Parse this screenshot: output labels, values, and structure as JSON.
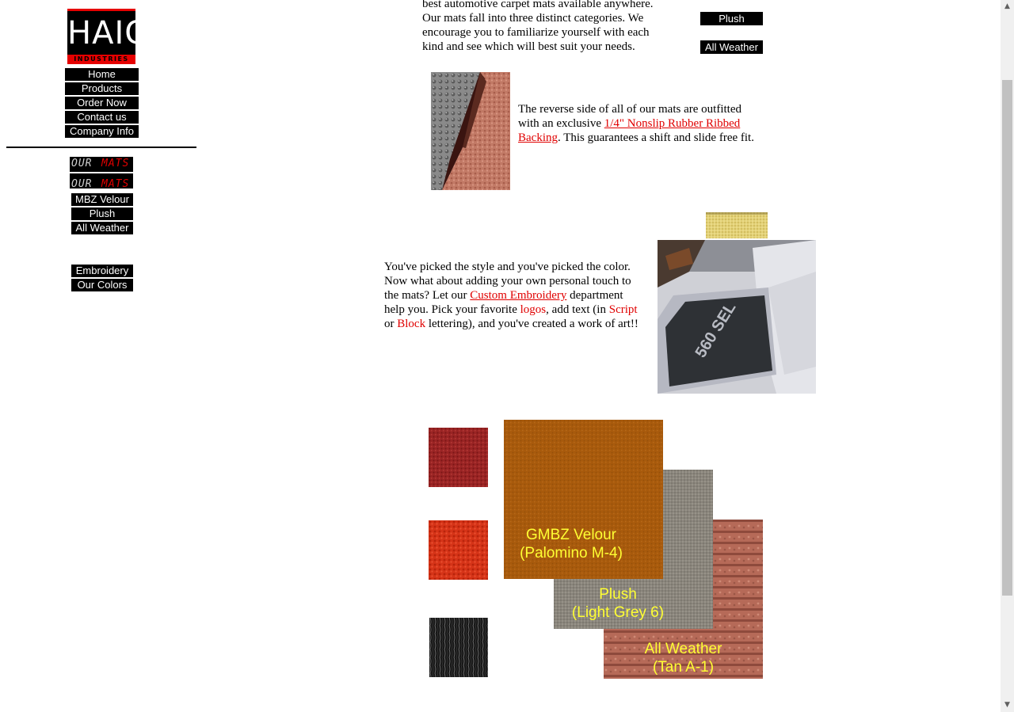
{
  "logo": {
    "word": "HAIG",
    "sub": "INDUSTRIES"
  },
  "nav": [
    "Home",
    "Products",
    "Order Now",
    "Contact us",
    "Company Info"
  ],
  "our_mats_banner": {
    "w1": "OUR",
    "w2": "MATS"
  },
  "mat_links": [
    "MBZ Velour",
    "Plush",
    "All Weather"
  ],
  "extra_links": [
    "Embroidery",
    "Our Colors"
  ],
  "intro": {
    "line1": "best automotive carpet mats available anywhere.",
    "line2": "Our mats fall into three distinct categories. We",
    "line3": "encourage you to familiarize yourself with each",
    "line4": "kind and see which will best suit your needs."
  },
  "right_buttons": [
    "Plush",
    "All Weather"
  ],
  "backing": {
    "pre": "The reverse side of all of our mats are outfitted with an exclusive ",
    "link": "1/4\" Nonslip Rubber Ribbed Backing",
    "post": ".  This guarantees a shift and slide free fit."
  },
  "embroidery": {
    "t1": "You've picked the style and you've picked the color. Now what about adding your own personal touch to the mats? Let our ",
    "link": "Custom Embroidery",
    "t2": " department help you. Pick your favorite ",
    "logos": "logos",
    "t3": ", add text (in ",
    "script": "Script",
    "t4": " or ",
    "block": "Block",
    "t5": " lettering), and you've created a work of art!!"
  },
  "car_mat_text": "560 SEL",
  "samples": {
    "velour": {
      "line1": "GMBZ Velour",
      "line2": "(Palomino M-4)"
    },
    "plush": {
      "line1": "Plush",
      "line2": "(Light Grey 6)"
    },
    "allweather": {
      "line1": "All Weather",
      "line2": "(Tan A-1)"
    }
  },
  "colors": {
    "nav_bg": "#000000",
    "link": "#e00000",
    "caption": "#ffff33",
    "velour": "#a85a0c",
    "plush": "#8a857c",
    "allweather": "#b66a58"
  }
}
